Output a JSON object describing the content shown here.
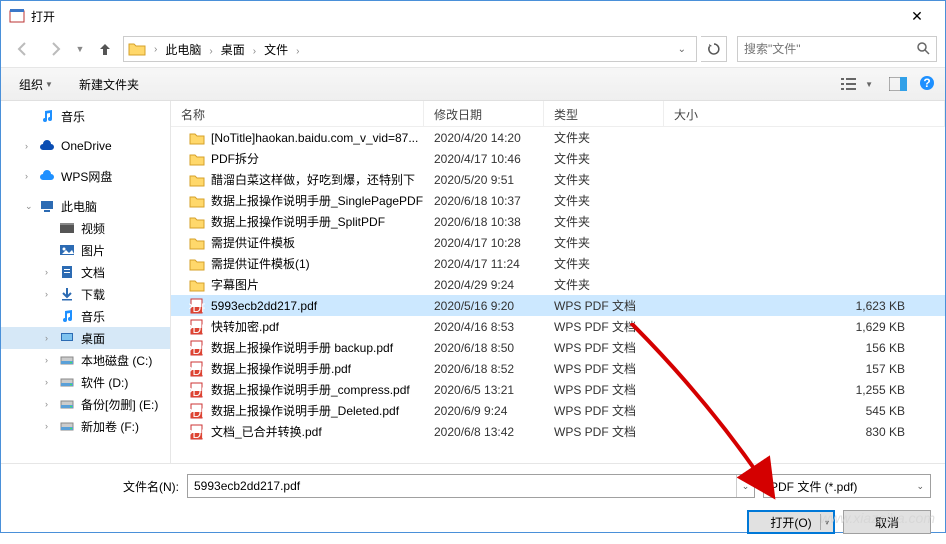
{
  "window": {
    "title": "打开"
  },
  "breadcrumb": {
    "items": [
      "此电脑",
      "桌面",
      "文件"
    ]
  },
  "search": {
    "placeholder": "搜索\"文件\""
  },
  "toolbar": {
    "organize": "组织",
    "newfolder": "新建文件夹"
  },
  "sidebar": [
    {
      "icon": "music",
      "color": "#1e90ff",
      "label": "音乐",
      "exp": "",
      "indent": 0
    },
    {
      "icon": "cloud",
      "color": "#0a4db3",
      "label": "OneDrive",
      "exp": "›",
      "indent": 0,
      "gapBefore": true
    },
    {
      "icon": "cloud",
      "color": "#1e90ff",
      "label": "WPS网盘",
      "exp": "›",
      "indent": 0,
      "gapBefore": true
    },
    {
      "icon": "pc",
      "color": "#2c6bb3",
      "label": "此电脑",
      "exp": "⌄",
      "indent": 0,
      "gapBefore": true
    },
    {
      "icon": "video",
      "color": "#444",
      "label": "视频",
      "exp": "",
      "indent": 1
    },
    {
      "icon": "pic",
      "color": "#2c6bb3",
      "label": "图片",
      "exp": "",
      "indent": 1
    },
    {
      "icon": "doc",
      "color": "#2c6bb3",
      "label": "文档",
      "exp": "›",
      "indent": 1
    },
    {
      "icon": "down",
      "color": "#2c6bb3",
      "label": "下载",
      "exp": "›",
      "indent": 1
    },
    {
      "icon": "music",
      "color": "#1e90ff",
      "label": "音乐",
      "exp": "",
      "indent": 1
    },
    {
      "icon": "desk",
      "color": "#2c6bb3",
      "label": "桌面",
      "exp": "›",
      "indent": 1,
      "selected": true
    },
    {
      "icon": "disk",
      "color": "#888",
      "label": "本地磁盘 (C:)",
      "exp": "›",
      "indent": 1
    },
    {
      "icon": "disk",
      "color": "#888",
      "label": "软件 (D:)",
      "exp": "›",
      "indent": 1
    },
    {
      "icon": "disk",
      "color": "#888",
      "label": "备份[勿删] (E:)",
      "exp": "›",
      "indent": 1
    },
    {
      "icon": "disk",
      "color": "#888",
      "label": "新加卷 (F:)",
      "exp": "›",
      "indent": 1
    }
  ],
  "columns": {
    "name": "名称",
    "date": "修改日期",
    "type": "类型",
    "size": "大小"
  },
  "files": [
    {
      "icon": "folder",
      "name": "[NoTitle]haokan.baidu.com_v_vid=87...",
      "date": "2020/4/20 14:20",
      "type": "文件夹",
      "size": ""
    },
    {
      "icon": "folder",
      "name": "PDF拆分",
      "date": "2020/4/17 10:46",
      "type": "文件夹",
      "size": ""
    },
    {
      "icon": "folder",
      "name": "醋溜白菜这样做，好吃到爆，还特别下",
      "date": "2020/5/20 9:51",
      "type": "文件夹",
      "size": ""
    },
    {
      "icon": "folder",
      "name": "数据上报操作说明手册_SinglePagePDF",
      "date": "2020/6/18 10:37",
      "type": "文件夹",
      "size": ""
    },
    {
      "icon": "folder",
      "name": "数据上报操作说明手册_SplitPDF",
      "date": "2020/6/18 10:38",
      "type": "文件夹",
      "size": ""
    },
    {
      "icon": "folder",
      "name": "需提供证件模板",
      "date": "2020/4/17 10:28",
      "type": "文件夹",
      "size": ""
    },
    {
      "icon": "folder",
      "name": "需提供证件模板(1)",
      "date": "2020/4/17 11:24",
      "type": "文件夹",
      "size": ""
    },
    {
      "icon": "folder",
      "name": "字幕图片",
      "date": "2020/4/29 9:24",
      "type": "文件夹",
      "size": ""
    },
    {
      "icon": "pdf",
      "name": "5993ecb2dd217.pdf",
      "date": "2020/5/16 9:20",
      "type": "WPS PDF 文档",
      "size": "1,623 KB",
      "selected": true
    },
    {
      "icon": "pdf",
      "name": "快转加密.pdf",
      "date": "2020/4/16 8:53",
      "type": "WPS PDF 文档",
      "size": "1,629 KB"
    },
    {
      "icon": "pdf",
      "name": "数据上报操作说明手册 backup.pdf",
      "date": "2020/6/18 8:50",
      "type": "WPS PDF 文档",
      "size": "156 KB"
    },
    {
      "icon": "pdf",
      "name": "数据上报操作说明手册.pdf",
      "date": "2020/6/18 8:52",
      "type": "WPS PDF 文档",
      "size": "157 KB"
    },
    {
      "icon": "pdf",
      "name": "数据上报操作说明手册_compress.pdf",
      "date": "2020/6/5 13:21",
      "type": "WPS PDF 文档",
      "size": "1,255 KB"
    },
    {
      "icon": "pdf",
      "name": "数据上报操作说明手册_Deleted.pdf",
      "date": "2020/6/9 9:24",
      "type": "WPS PDF 文档",
      "size": "545 KB"
    },
    {
      "icon": "pdf",
      "name": "文档_已合并转换.pdf",
      "date": "2020/6/8 13:42",
      "type": "WPS PDF 文档",
      "size": "830 KB"
    }
  ],
  "footer": {
    "filename_label": "文件名(N):",
    "filename_value": "5993ecb2dd217.pdf",
    "filetype": "PDF 文件 (*.pdf)",
    "open": "打开(O)",
    "cancel": "取消"
  },
  "watermark": "www.xiazaiba.com"
}
